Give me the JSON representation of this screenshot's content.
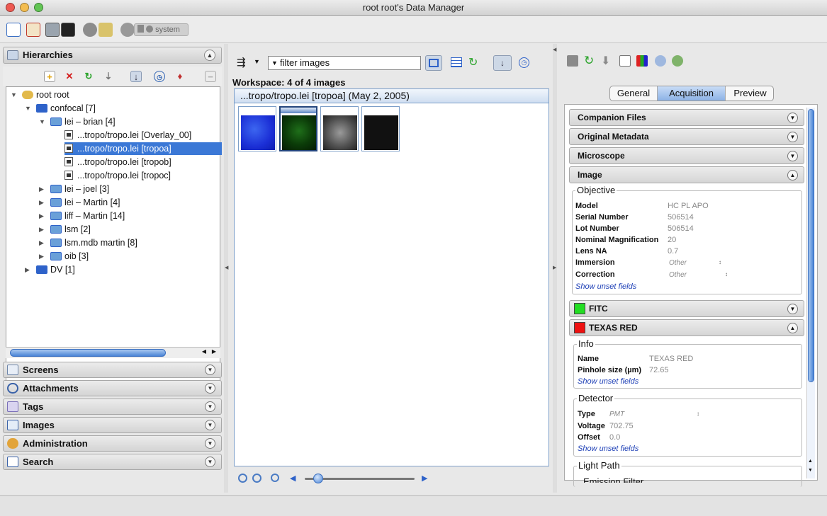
{
  "window": {
    "title": "root root's Data Manager"
  },
  "toolbar": {
    "system_label": "system"
  },
  "hierarchies": {
    "title": "Hierarchies",
    "tree": [
      {
        "label": "root root"
      },
      {
        "label": "confocal [7]"
      },
      {
        "label": "lei – brian [4]"
      },
      {
        "label": "...tropo/tropo.lei [Overlay_00]"
      },
      {
        "label": "...tropo/tropo.lei [tropoa]"
      },
      {
        "label": "...tropo/tropo.lei [tropob]"
      },
      {
        "label": "...tropo/tropo.lei [tropoc]"
      },
      {
        "label": "lei – joel [3]"
      },
      {
        "label": "lei – Martin [4]"
      },
      {
        "label": "liff – Martin [14]"
      },
      {
        "label": "lsm [2]"
      },
      {
        "label": "lsm.mdb martin [8]"
      },
      {
        "label": "oib [3]"
      },
      {
        "label": "DV [1]"
      }
    ]
  },
  "left_sections": [
    {
      "label": "Screens"
    },
    {
      "label": "Attachments"
    },
    {
      "label": "Tags"
    },
    {
      "label": "Images"
    },
    {
      "label": "Administration"
    },
    {
      "label": "Search"
    }
  ],
  "center": {
    "filter_text": "filter  images",
    "workspace_label": "Workspace: 4 of 4 images",
    "group_header": "...tropo/tropo.lei [tropoa] (May 2, 2005)"
  },
  "right": {
    "tabs": [
      "General",
      "Acquisition",
      "Preview"
    ],
    "active_tab": "Acquisition",
    "sections": {
      "companion": "Companion Files",
      "original": "Original Metadata",
      "microscope": "Microscope",
      "image": "Image",
      "fitc": "FITC",
      "texas": "TEXAS RED"
    },
    "objective": {
      "legend": "Objective",
      "model_l": "Model",
      "model_v": "HC PL APO",
      "serial_l": "Serial Number",
      "serial_v": "506514",
      "lot_l": "Lot Number",
      "lot_v": "506514",
      "mag_l": "Nominal Magnification",
      "mag_v": "20",
      "na_l": "Lens NA",
      "na_v": "0.7",
      "imm_l": "Immersion",
      "imm_v": "Other",
      "corr_l": "Correction",
      "corr_v": "Other",
      "unset": "Show unset fields"
    },
    "info": {
      "legend": "Info",
      "name_l": "Name",
      "name_v": "TEXAS RED",
      "pin_l": "Pinhole size (µm)",
      "pin_v": "72.65",
      "unset": "Show unset fields"
    },
    "detector": {
      "legend": "Detector",
      "type_l": "Type",
      "type_v": "PMT",
      "volt_l": "Voltage",
      "volt_v": "702.75",
      "off_l": "Offset",
      "off_v": "0.0",
      "unset": "Show unset fields"
    },
    "lightpath": {
      "legend": "Light Path",
      "emission": "Emission Filter"
    }
  },
  "colors": {
    "fitc": "#22dd22",
    "texas": "#ee1111",
    "selection": "#3b78d6"
  }
}
